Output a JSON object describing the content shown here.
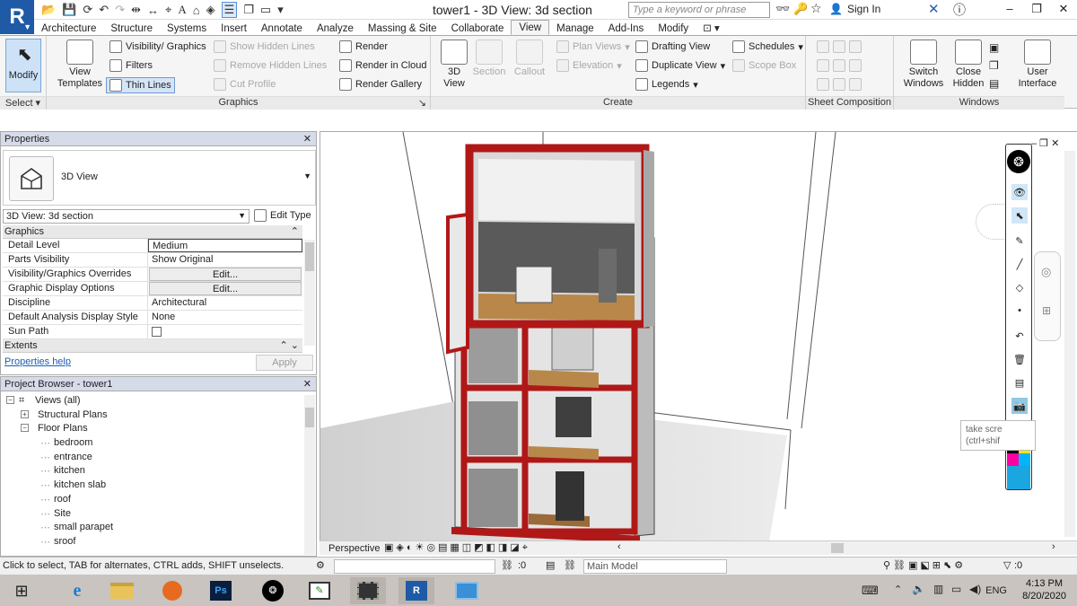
{
  "app": {
    "logo_letter": "R",
    "title": "tower1 - 3D View: 3d section",
    "search_placeholder": "Type a keyword or phrase",
    "sign_in": "Sign In"
  },
  "menu_tabs": [
    "Architecture",
    "Structure",
    "Systems",
    "Insert",
    "Annotate",
    "Analyze",
    "Massing & Site",
    "Collaborate",
    "View",
    "Manage",
    "Add-Ins",
    "Modify"
  ],
  "active_tab": "View",
  "ribbon": {
    "modify": "Modify",
    "select": "Select",
    "view_templates": "View Templates",
    "visibility_graphics": "Visibility/ Graphics",
    "filters": "Filters",
    "thin_lines": "Thin Lines",
    "show_hidden_lines": "Show Hidden Lines",
    "remove_hidden_lines": "Remove Hidden Lines",
    "cut_profile": "Cut Profile",
    "render": "Render",
    "render_in_cloud": "Render in Cloud",
    "render_gallery": "Render Gallery",
    "graphics_label": "Graphics",
    "three_d_view": "3D View",
    "section": "Section",
    "callout": "Callout",
    "plan_views": "Plan Views",
    "elevation": "Elevation",
    "drafting_view": "Drafting View",
    "duplicate_view": "Duplicate View",
    "legends": "Legends",
    "schedules": "Schedules",
    "scope_box": "Scope Box",
    "create_label": "Create",
    "sheet_composition_label": "Sheet Composition",
    "switch_windows": "Switch Windows",
    "close_hidden": "Close Hidden",
    "user_interface": "User Interface",
    "windows_label": "Windows"
  },
  "properties": {
    "title": "Properties",
    "type_name": "3D View",
    "instance": "3D View: 3d section",
    "edit_type": "Edit Type",
    "category_graphics": "Graphics",
    "rows": [
      {
        "k": "Detail Level",
        "v": "Medium"
      },
      {
        "k": "Parts Visibility",
        "v": "Show Original"
      },
      {
        "k": "Visibility/Graphics Overrides",
        "v": "Edit..."
      },
      {
        "k": "Graphic Display Options",
        "v": "Edit..."
      },
      {
        "k": "Discipline",
        "v": "Architectural"
      },
      {
        "k": "Default Analysis Display Style",
        "v": "None"
      },
      {
        "k": "Sun Path",
        "v": ""
      }
    ],
    "category_extents": "Extents",
    "help": "Properties help",
    "apply": "Apply"
  },
  "browser": {
    "title": "Project Browser - tower1",
    "views_all": "Views (all)",
    "structural_plans": "Structural Plans",
    "floor_plans": "Floor Plans",
    "plans": [
      "bedroom",
      "entrance",
      "kitchen",
      "kitchen slab",
      "roof",
      "Site",
      "small parapet",
      "sroof"
    ]
  },
  "viewport": {
    "view_mode": "Perspective",
    "tooltip_line1": "take scre",
    "tooltip_line2": "(ctrl+shif"
  },
  "status": {
    "text": "Click to select, TAB for alternates, CTRL adds, SHIFT unselects.",
    "count1": ":0",
    "model": "Main Model",
    "count2": ":0"
  },
  "taskbar": {
    "time": "4:13 PM",
    "date": "8/20/2020",
    "lang": "ENG"
  }
}
